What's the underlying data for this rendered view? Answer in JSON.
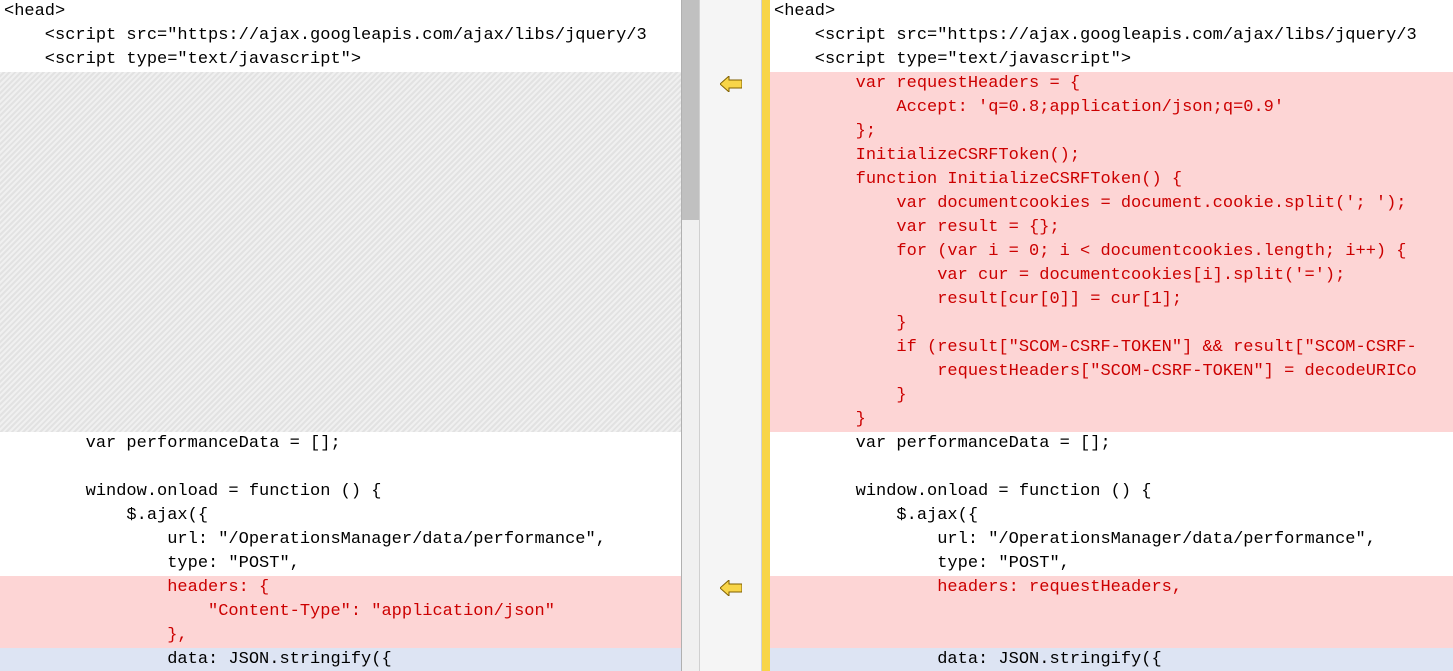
{
  "left": {
    "l1": "<head>",
    "l2": "    <script src=\"https://ajax.googleapis.com/ajax/libs/jquery/3",
    "l3": "    <script type=\"text/javascript\">",
    "l4": "        var performanceData = [];",
    "l5": "",
    "l6": "        window.onload = function () {",
    "l7": "            $.ajax({",
    "l8": "                url: \"/OperationsManager/data/performance\",",
    "l9": "                type: \"POST\",",
    "l10": "                headers: {",
    "l11": "                    \"Content-Type\": \"application/json\"",
    "l12": "                },",
    "l13": "                data: JSON.stringify({"
  },
  "right": {
    "r1": "<head>",
    "r2": "    <script src=\"https://ajax.googleapis.com/ajax/libs/jquery/3",
    "r3": "    <script type=\"text/javascript\">",
    "r4": "        var requestHeaders = {",
    "r5": "            Accept: 'q=0.8;application/json;q=0.9'",
    "r6": "        };",
    "r7": "        InitializeCSRFToken();",
    "r8": "        function InitializeCSRFToken() {",
    "r9": "            var documentcookies = document.cookie.split('; ');",
    "r10": "            var result = {};",
    "r11": "            for (var i = 0; i < documentcookies.length; i++) {",
    "r12": "                var cur = documentcookies[i].split('=');",
    "r13": "                result[cur[0]] = cur[1];",
    "r14": "            }",
    "r15": "            if (result[\"SCOM-CSRF-TOKEN\"] && result[\"SCOM-CSRF-",
    "r16": "                requestHeaders[\"SCOM-CSRF-TOKEN\"] = decodeURICo",
    "r17": "            }",
    "r18": "        }",
    "r19": "        var performanceData = [];",
    "r20": "",
    "r21": "        window.onload = function () {",
    "r22": "            $.ajax({",
    "r23": "                url: \"/OperationsManager/data/performance\",",
    "r24": "                type: \"POST\",",
    "r25": "                headers: requestHeaders,",
    "r26": "                data: JSON.stringify({"
  },
  "icons": {
    "arrow_left": "⇦"
  }
}
